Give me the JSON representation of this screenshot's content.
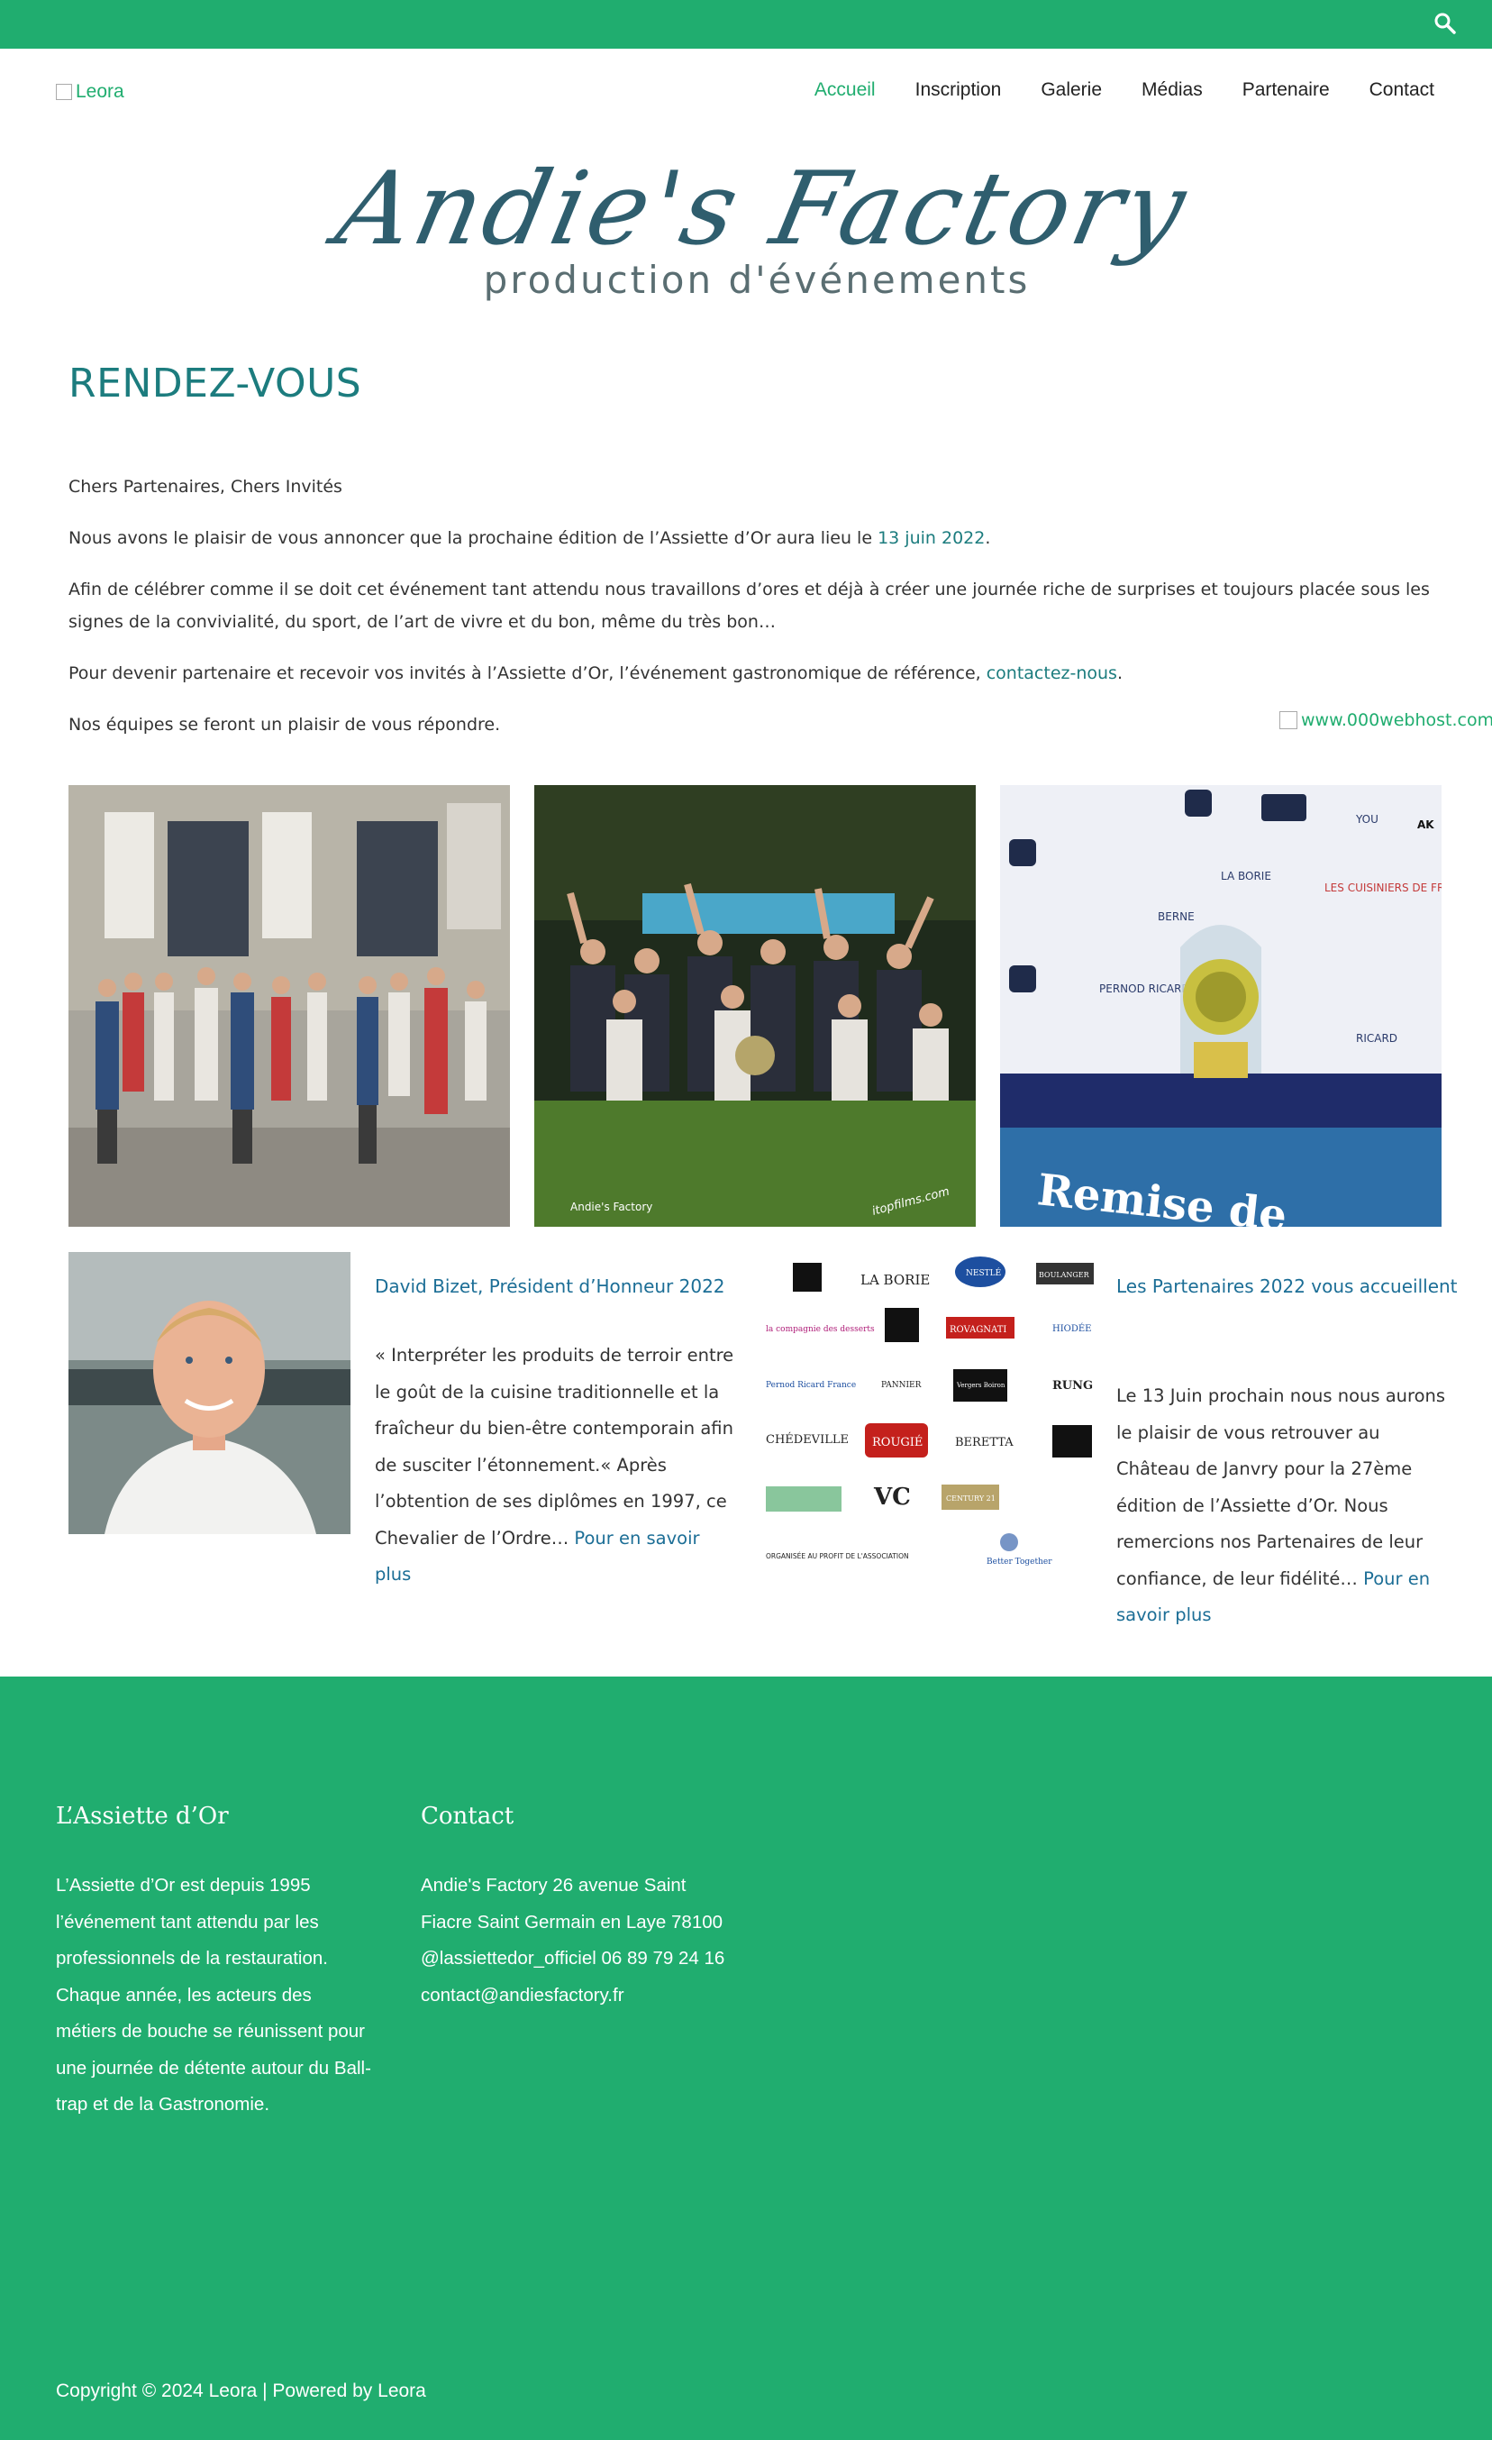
{
  "header": {
    "logo_alt": "Leora",
    "nav": [
      "Accueil",
      "Inscription",
      "Galerie",
      "Médias",
      "Partenaire",
      "Contact"
    ]
  },
  "banner": {
    "script_text": "Andie's Factory",
    "sub_text": "production d'événements"
  },
  "main": {
    "title": "RENDEZ-VOUS",
    "p1": "Chers Partenaires, Chers Invités",
    "p2_before": "Nous avons le plaisir de vous annoncer que la prochaine édition de l’Assiette d’Or aura lieu le ",
    "p2_link": "13 juin 2022",
    "p2_after": ".",
    "p3": "Afin de célébrer comme il se doit cet événement tant attendu nous travaillons d’ores et déjà à créer une journée riche de surprises et toujours placée sous les signes de la convivialité, du sport, de l’art de vivre et du bon, même du très bon…",
    "p4_before": "Pour devenir partenaire et recevoir vos invités à l’Assiette d’Or, l’événement gastronomique de référence, ",
    "p4_link": "contactez-nous",
    "p4_after": ".",
    "p5": "Nos équipes se feront un plaisir de vous répondre.",
    "badge_alt": "www.000webhost.com"
  },
  "president": {
    "title": "David Bizet, Président d’Honneur 2022",
    "text": "« Interpréter les produits de terroir entre le goût de la cuisine traditionnelle et la fraîcheur du bien-être contemporain afin de susciter l’étonnement.«  Après l’obtention de ses diplômes en 1997, ce Chevalier de l’Ordre",
    "ellipsis": "… ",
    "more": "Pour en savoir plus"
  },
  "partners": {
    "title": "Les Partenaires 2022 vous accueillent",
    "text": "Le 13 Juin prochain nous nous aurons le plaisir de vous retrouver au Château de Janvry pour la 27ème édition de l’Assiette d’Or. Nous remercions nos Partenaires de leur confiance, de leur fidélité",
    "ellipsis": "… ",
    "more": "Pour en savoir plus",
    "logos": [
      "LA BORIE",
      "NESTLÉ",
      "BOULANGER",
      "la compagnie des desserts",
      "ROVAGNATI",
      "HIODÉE",
      "Pernod Ricard France",
      "PANNIER",
      "Vergers Boiron",
      "RUNG",
      "CHÉDEVILLE",
      "ROUGIÉ",
      "BERETTA",
      "VC",
      "CENTURY 21",
      "ORGANISÉE AU PROFIT DE L'ASSOCIATION",
      "Better Together"
    ],
    "trophy_caption": "Remise de",
    "trophy_logos": [
      "LA BORIE",
      "LES CUISINIERS DE FRANCE",
      "RICARD",
      "PERNOD RICARD",
      "BERNE",
      "YOU",
      "AK"
    ]
  },
  "gallery": {
    "photo2_credit": "Andie's Factory",
    "photo2_watermark": "itopfilms.com"
  },
  "footer": {
    "col1_title": "L’Assiette d’Or",
    "col1_text": "L’Assiette d’Or est depuis 1995 l’événement tant attendu par les professionnels de la restauration. Chaque année, les acteurs des métiers de bouche se réunissent pour une journée de détente autour du Ball-trap et de la Gastronomie.",
    "col2_title": "Contact",
    "col2_text": "Andie's Factory 26 avenue Saint Fiacre Saint Germain en Laye 78100 @lassiettedor_officiel 06 89 79 24 16 contact@andiesfactory.fr",
    "copyright": "Copyright © 2024 Leora | Powered by Leora"
  },
  "colors": {
    "brand_green": "#20ad6f",
    "title_teal": "#1c7c7e",
    "link_blue": "#1c6e96"
  }
}
